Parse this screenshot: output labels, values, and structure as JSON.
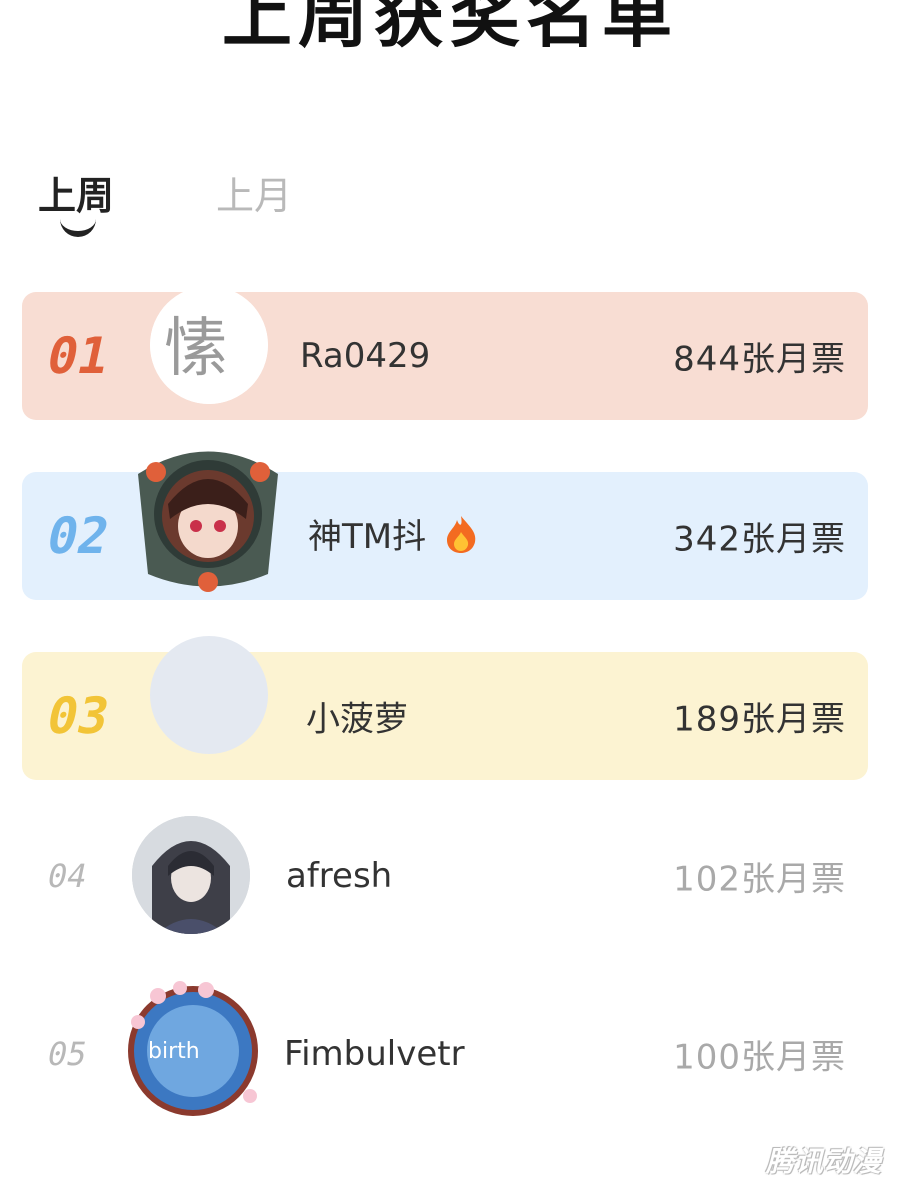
{
  "page": {
    "title": "上周获奖名单"
  },
  "tabs": [
    {
      "label": "上周",
      "active": true
    },
    {
      "label": "上月",
      "active": false
    }
  ],
  "ranking": [
    {
      "rank": "01",
      "name": "Ra0429",
      "votes": "844张月票",
      "bg": "#f8ddd3",
      "rank_color": "#e0603a",
      "avatar": "text-avatar"
    },
    {
      "rank": "02",
      "name": "神TM抖",
      "votes": "342张月票",
      "bg": "#e3f0fd",
      "rank_color": "#6fb3ec",
      "avatar": "anime-avatar",
      "emoji": "fire-icon"
    },
    {
      "rank": "03",
      "name": "小菠萝",
      "votes": "189张月票",
      "bg": "#fcf3d2",
      "rank_color": "#f2c437",
      "avatar": "blank-avatar"
    },
    {
      "rank": "04",
      "name": "afresh",
      "votes": "102张月票",
      "bg": "#ffffff",
      "rank_color": "#b8b8b8",
      "avatar": "anime-avatar-dark"
    },
    {
      "rank": "05",
      "name": "Fimbulvetr",
      "votes": "100张月票",
      "bg": "#ffffff",
      "rank_color": "#b8b8b8",
      "avatar": "sakura-avatar"
    }
  ],
  "watermark": "腾讯动漫"
}
